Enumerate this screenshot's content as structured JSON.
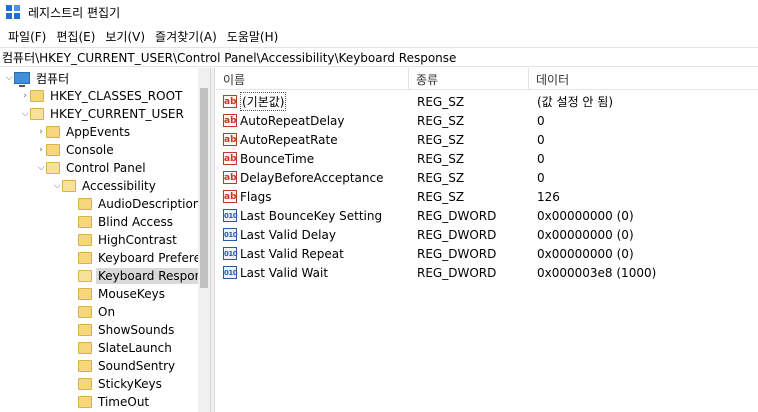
{
  "window": {
    "title": "레지스트리 편집기"
  },
  "menu": [
    "파일(F)",
    "편집(E)",
    "보기(V)",
    "즐겨찾기(A)",
    "도움말(H)"
  ],
  "address": "컴퓨터\\HKEY_CURRENT_USER\\Control Panel\\Accessibility\\Keyboard Response",
  "tree": {
    "root": "컴퓨터",
    "hkcr": "HKEY_CLASSES_ROOT",
    "hkcu": "HKEY_CURRENT_USER",
    "appevents": "AppEvents",
    "console": "Console",
    "control_panel": "Control Panel",
    "accessibility": "Accessibility",
    "children": [
      "AudioDescription",
      "Blind Access",
      "HighContrast",
      "Keyboard Preference",
      "Keyboard Response",
      "MouseKeys",
      "On",
      "ShowSounds",
      "SlateLaunch",
      "SoundSentry",
      "StickyKeys",
      "TimeOut"
    ]
  },
  "columns": {
    "name": "이름",
    "type": "종류",
    "data": "데이터"
  },
  "values": [
    {
      "name": "(기본값)",
      "type": "REG_SZ",
      "data": "(값 설정 안 됨)",
      "icon": "string-icon"
    },
    {
      "name": "AutoRepeatDelay",
      "type": "REG_SZ",
      "data": "0",
      "icon": "string-icon"
    },
    {
      "name": "AutoRepeatRate",
      "type": "REG_SZ",
      "data": "0",
      "icon": "string-icon"
    },
    {
      "name": "BounceTime",
      "type": "REG_SZ",
      "data": "0",
      "icon": "string-icon"
    },
    {
      "name": "DelayBeforeAcceptance",
      "type": "REG_SZ",
      "data": "0",
      "icon": "string-icon"
    },
    {
      "name": "Flags",
      "type": "REG_SZ",
      "data": "126",
      "icon": "string-icon"
    },
    {
      "name": "Last BounceKey Setting",
      "type": "REG_DWORD",
      "data": "0x00000000 (0)",
      "icon": "binary-icon"
    },
    {
      "name": "Last Valid Delay",
      "type": "REG_DWORD",
      "data": "0x00000000 (0)",
      "icon": "binary-icon"
    },
    {
      "name": "Last Valid Repeat",
      "type": "REG_DWORD",
      "data": "0x00000000 (0)",
      "icon": "binary-icon"
    },
    {
      "name": "Last Valid Wait",
      "type": "REG_DWORD",
      "data": "0x000003e8 (1000)",
      "icon": "binary-icon"
    }
  ]
}
